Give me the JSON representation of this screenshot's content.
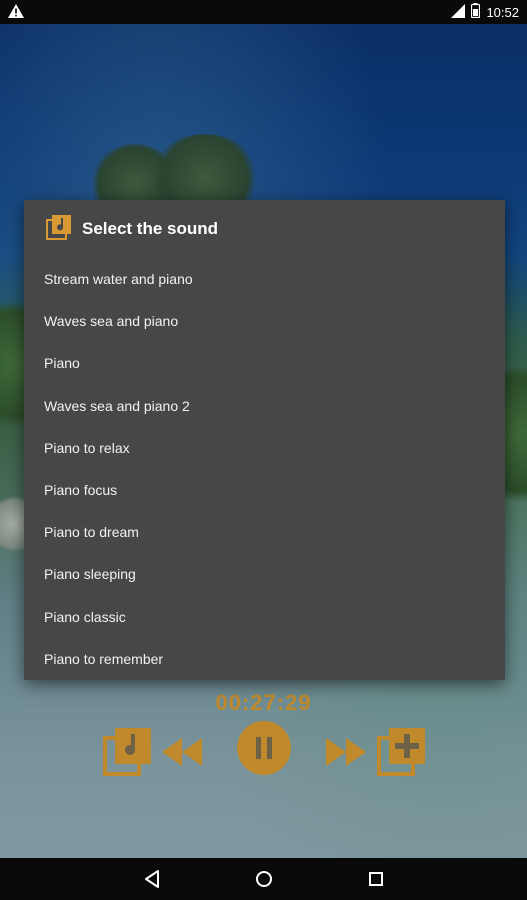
{
  "status_bar": {
    "time": "10:52",
    "icons": [
      "warning-icon",
      "signal-icon",
      "battery-icon"
    ]
  },
  "dialog": {
    "title": "Select the sound",
    "icon": "music-library-icon",
    "items": [
      {
        "label": "Stream water and piano"
      },
      {
        "label": "Waves sea and piano"
      },
      {
        "label": "Piano"
      },
      {
        "label": "Waves sea and piano 2"
      },
      {
        "label": "Piano to relax"
      },
      {
        "label": "Piano focus"
      },
      {
        "label": "Piano to dream"
      },
      {
        "label": "Piano sleeping"
      },
      {
        "label": "Piano classic"
      },
      {
        "label": "Piano to remember"
      }
    ]
  },
  "player": {
    "timer": "00:27:29",
    "accent_color": "#c08a2c",
    "controls": [
      "music-library-icon",
      "rewind-icon",
      "pause-icon",
      "fast-forward-icon",
      "add-playlist-icon"
    ]
  },
  "nav_bar": {
    "buttons": [
      "back-icon",
      "home-icon",
      "recents-icon"
    ]
  }
}
